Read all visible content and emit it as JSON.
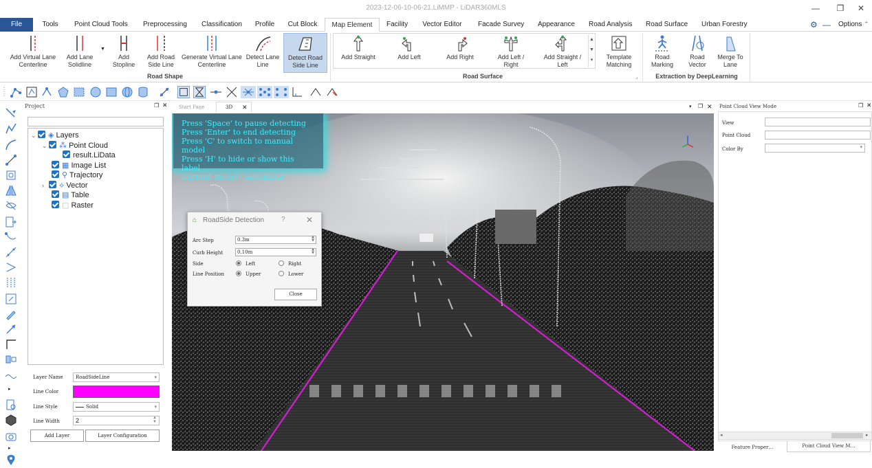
{
  "window": {
    "title": "2023-12-06-10-06-21.LiMMP - LiDAR360MLS",
    "options_label": "Options"
  },
  "menu": {
    "file": "File",
    "tabs": [
      "Tools",
      "Point Cloud Tools",
      "Preprocessing",
      "Classification",
      "Profile",
      "Cut Block",
      "Map Element",
      "Facility",
      "Vector Editor",
      "Facade Survey",
      "Appearance",
      "Road Analysis",
      "Road Surface",
      "Urban Forestry"
    ],
    "active": "Map Element"
  },
  "ribbon": {
    "road_shape": {
      "label": "Road Shape",
      "buttons": [
        "Add Virtual Lane Centerline",
        "Add Lane Solidline",
        "Add Stopline",
        "Add Road Side Line",
        "Generate Virtual Lane Centerline",
        "Detect Lane Line",
        "Detect Road Side Line"
      ],
      "selected": "Detect Road Side Line"
    },
    "road_surface": {
      "label": "Road Surface",
      "buttons": [
        "Add Straight",
        "Add Left",
        "Add Right",
        "Add Left / Right",
        "Add Straight / Left"
      ],
      "template": "Template Matching"
    },
    "deep_learning": {
      "label": "Extraction by DeepLearning",
      "buttons": [
        "Road Marking",
        "Road Vector",
        "Merge To Lane"
      ]
    }
  },
  "project": {
    "title": "Project",
    "tree": [
      {
        "label": "Layers",
        "level": 0,
        "expanded": true
      },
      {
        "label": "Point Cloud",
        "level": 1,
        "expanded": true
      },
      {
        "label": "result.LiData",
        "level": 2
      },
      {
        "label": "Image List",
        "level": 1
      },
      {
        "label": "Trajectory",
        "level": 1
      },
      {
        "label": "Vector",
        "level": 1,
        "collapsed": true
      },
      {
        "label": "Table",
        "level": 1
      },
      {
        "label": "Raster",
        "level": 1
      }
    ]
  },
  "layer_props": {
    "name_label": "Layer Name",
    "name_value": "RoadSideLine",
    "color_label": "Line Color",
    "color_value": "#ff00ff",
    "style_label": "Line Style",
    "style_value": "Solid",
    "width_label": "Line Width",
    "width_value": "2",
    "add_layer": "Add Layer",
    "layer_config": "Layer Configuration"
  },
  "viewer": {
    "tabs": [
      "Start Page",
      "3D"
    ],
    "active_tab": "3D",
    "hint_lines": [
      "Press 'Space' to pause detecting",
      "Press 'Enter' to end detecting",
      "Press 'C' to switch to manual model",
      "Press 'H' to hide or show this label",
      "Current model : Automatic"
    ]
  },
  "dialog": {
    "title": "RoadSide Detection",
    "help": "?",
    "arc_step_label": "Arc Step",
    "arc_step_value": "0.3m",
    "curb_height_label": "Curb Height",
    "curb_height_value": "0.10m",
    "side_label": "Side",
    "side_left": "Left",
    "side_right": "Right",
    "line_position_label": "Line Position",
    "pos_upper": "Upper",
    "pos_lower": "Lower",
    "close": "Close"
  },
  "right_panel": {
    "title": "Point Cloud View Mode",
    "view_label": "View",
    "point_cloud_label": "Point Cloud",
    "color_by_label": "Color By",
    "tab_feature": "Feature Proper…",
    "tab_pcview": "Point Cloud View M…"
  },
  "colors": {
    "accent": "#2b5797",
    "road_line": "#d21fd2",
    "hint_text": "#39f0ff"
  }
}
